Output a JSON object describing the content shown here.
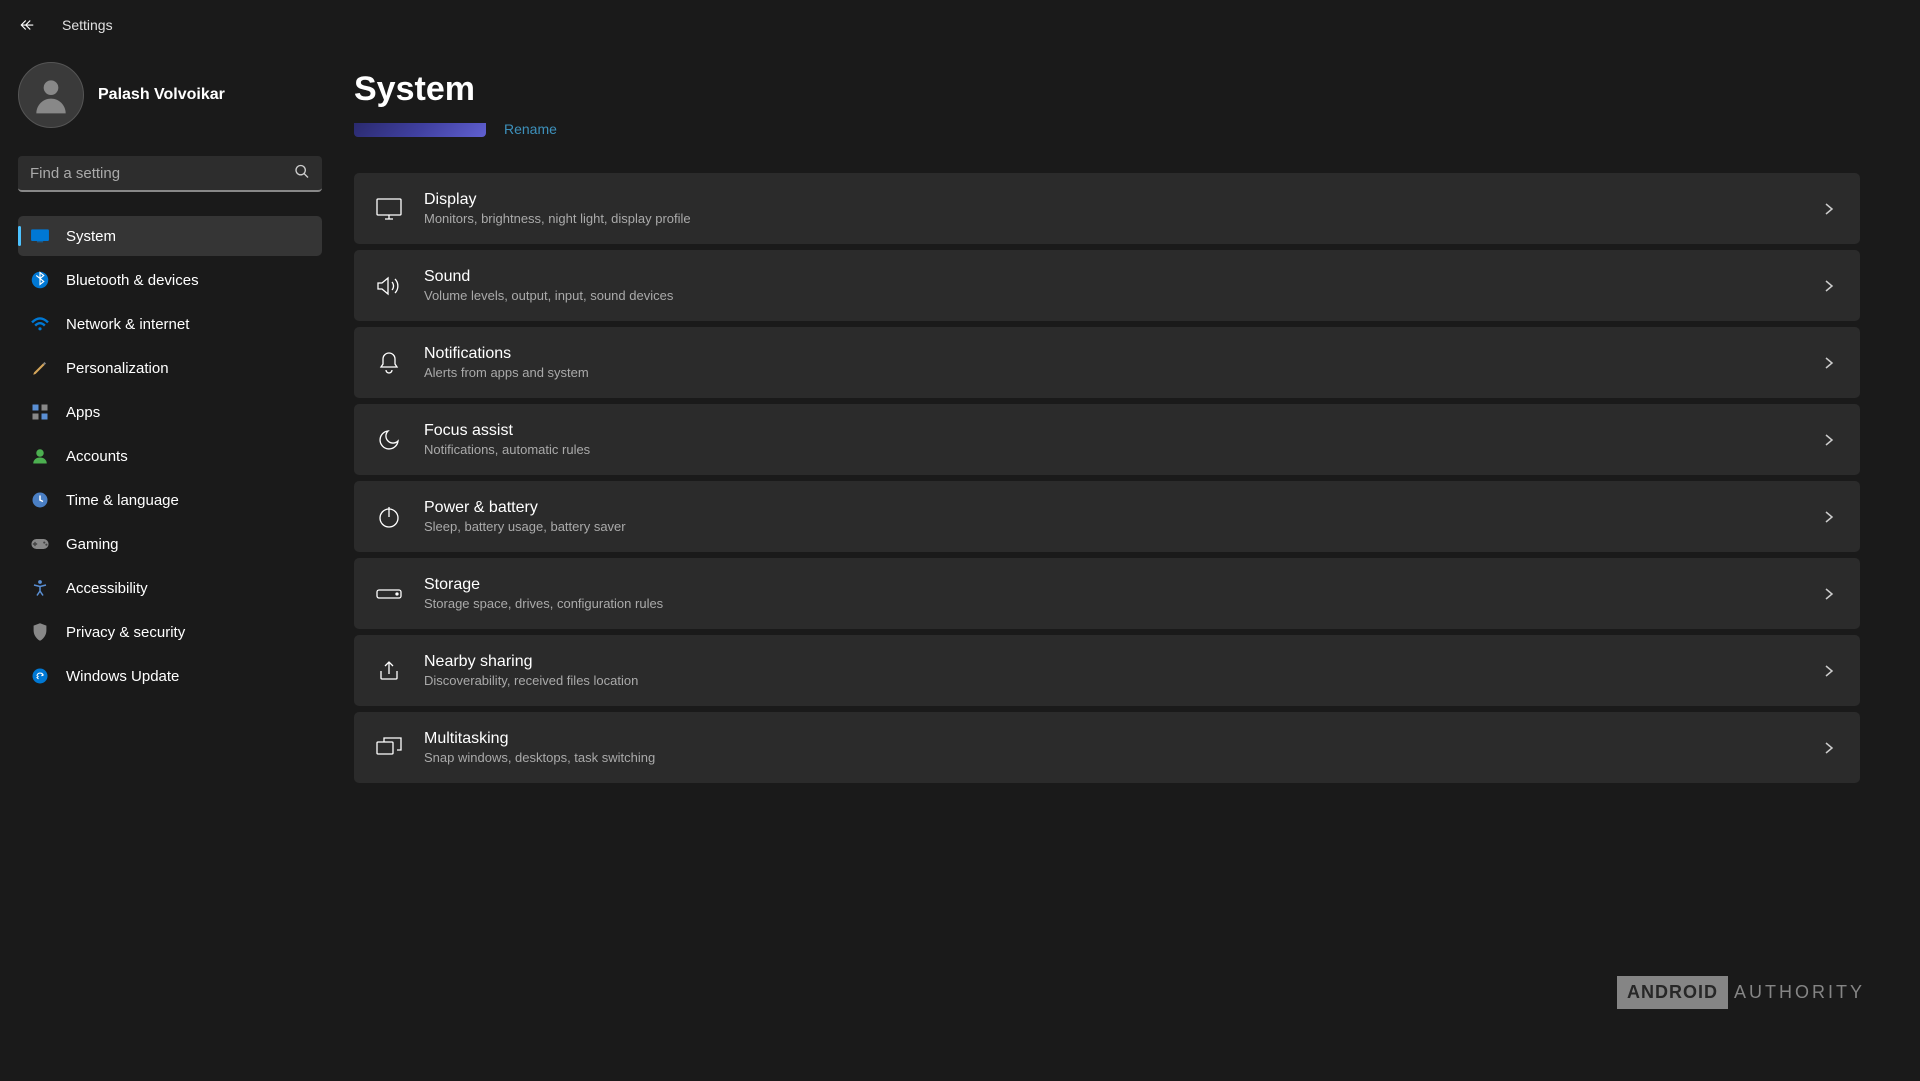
{
  "titlebar": {
    "title": "Settings"
  },
  "user": {
    "name": "Palash Volvoikar"
  },
  "search": {
    "placeholder": "Find a setting"
  },
  "nav": [
    {
      "label": "System",
      "icon": "system",
      "active": true
    },
    {
      "label": "Bluetooth & devices",
      "icon": "bluetooth",
      "active": false
    },
    {
      "label": "Network & internet",
      "icon": "network",
      "active": false
    },
    {
      "label": "Personalization",
      "icon": "personalization",
      "active": false
    },
    {
      "label": "Apps",
      "icon": "apps",
      "active": false
    },
    {
      "label": "Accounts",
      "icon": "accounts",
      "active": false
    },
    {
      "label": "Time & language",
      "icon": "time",
      "active": false
    },
    {
      "label": "Gaming",
      "icon": "gaming",
      "active": false
    },
    {
      "label": "Accessibility",
      "icon": "accessibility",
      "active": false
    },
    {
      "label": "Privacy & security",
      "icon": "privacy",
      "active": false
    },
    {
      "label": "Windows Update",
      "icon": "update",
      "active": false
    }
  ],
  "page": {
    "title": "System",
    "rename": "Rename"
  },
  "settings": [
    {
      "title": "Display",
      "desc": "Monitors, brightness, night light, display profile",
      "icon": "display"
    },
    {
      "title": "Sound",
      "desc": "Volume levels, output, input, sound devices",
      "icon": "sound"
    },
    {
      "title": "Notifications",
      "desc": "Alerts from apps and system",
      "icon": "notifications"
    },
    {
      "title": "Focus assist",
      "desc": "Notifications, automatic rules",
      "icon": "focus"
    },
    {
      "title": "Power & battery",
      "desc": "Sleep, battery usage, battery saver",
      "icon": "power"
    },
    {
      "title": "Storage",
      "desc": "Storage space, drives, configuration rules",
      "icon": "storage"
    },
    {
      "title": "Nearby sharing",
      "desc": "Discoverability, received files location",
      "icon": "share"
    },
    {
      "title": "Multitasking",
      "desc": "Snap windows, desktops, task switching",
      "icon": "multitask"
    }
  ],
  "watermark": {
    "box": "ANDROID",
    "text": "AUTHORITY"
  }
}
